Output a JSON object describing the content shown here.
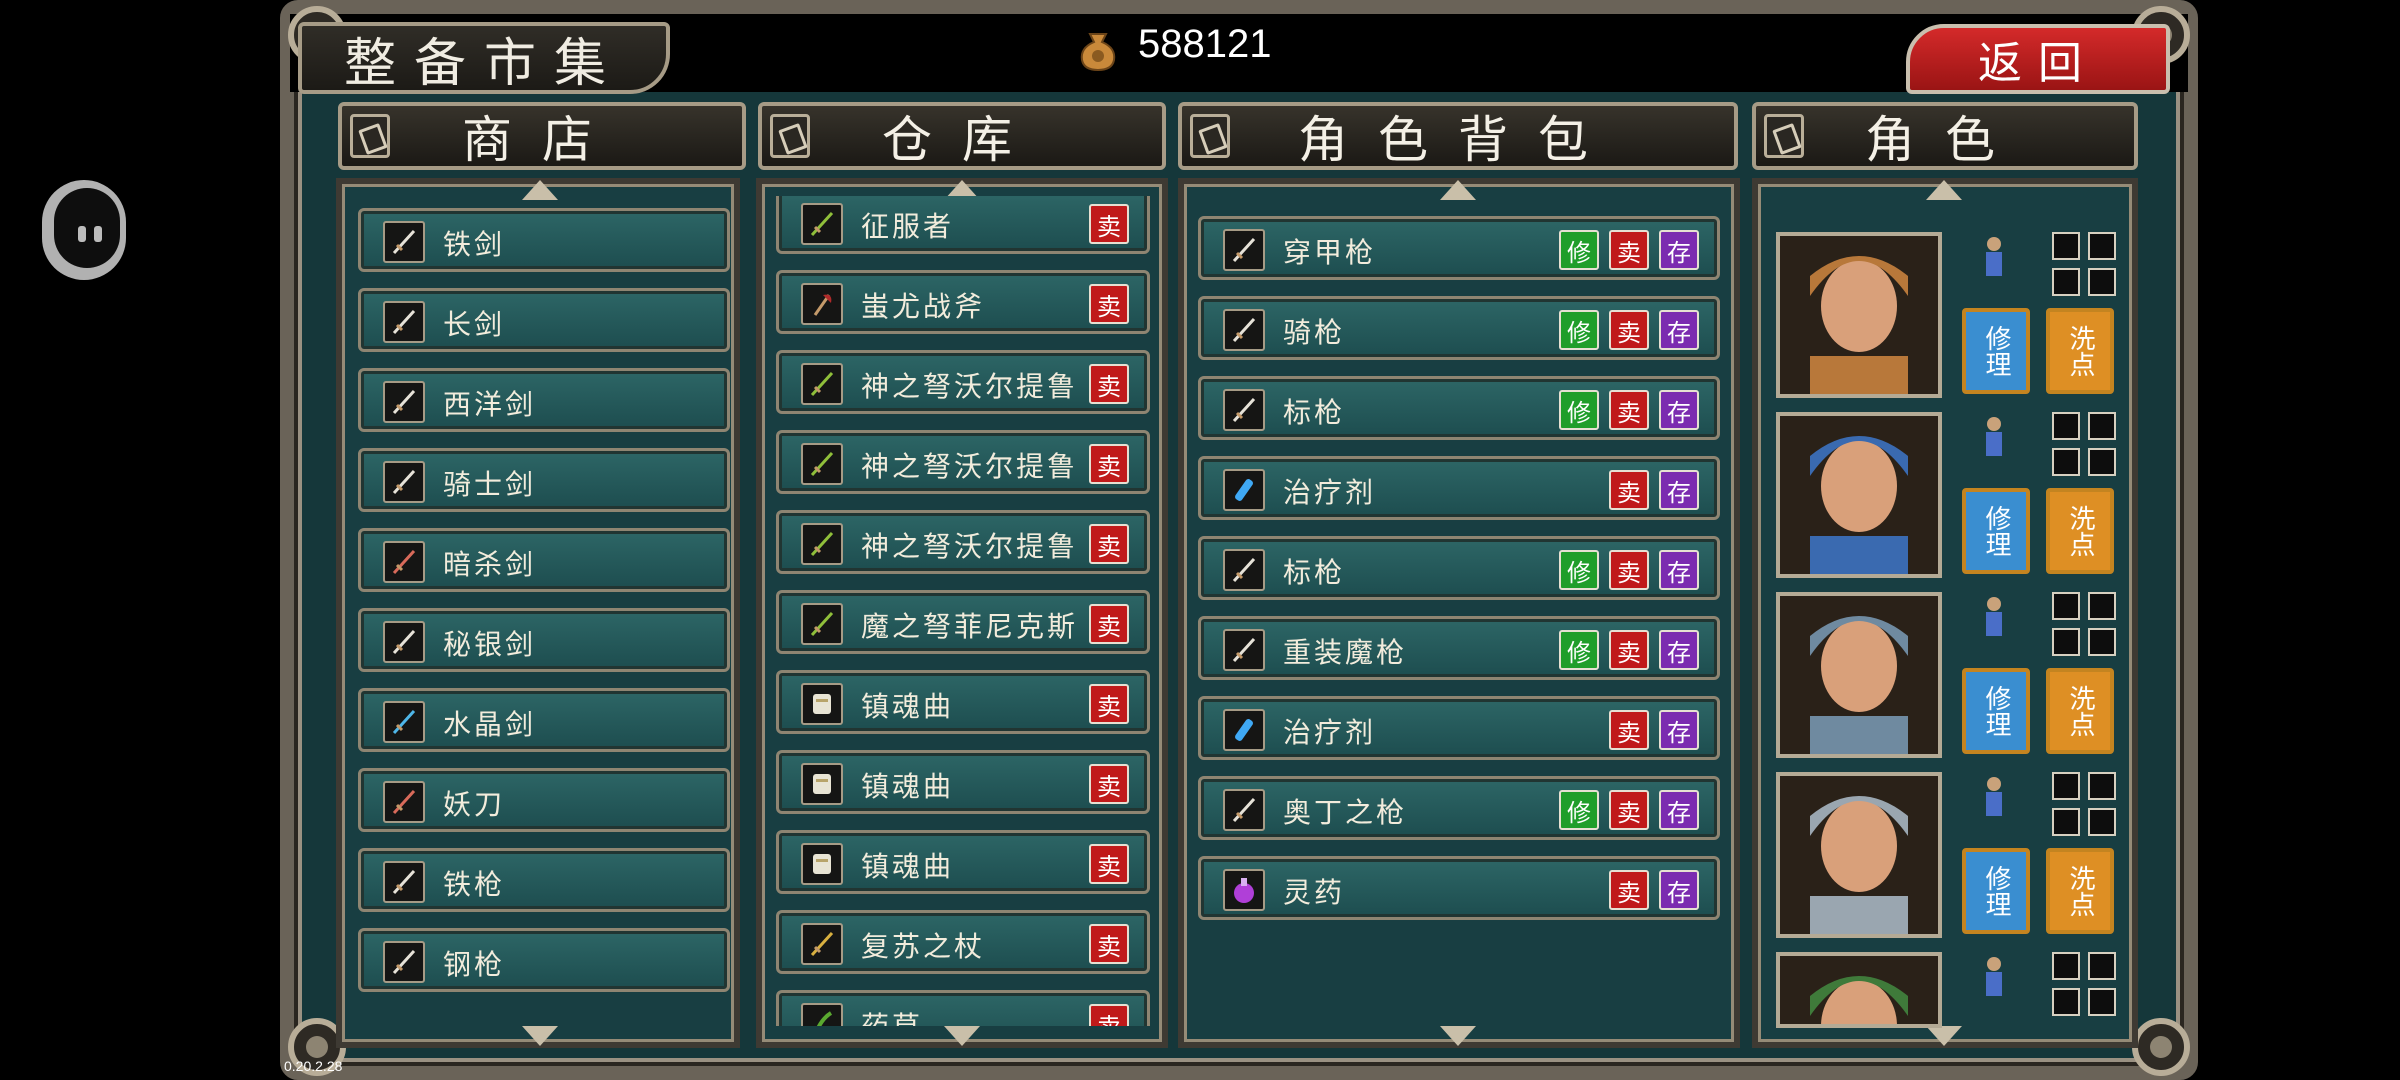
{
  "header": {
    "title": "整备市集",
    "gold_amount": "588121",
    "back_label": "返回",
    "gold_icon": "coin-bag-icon"
  },
  "columns": {
    "shop": "商店",
    "warehouse": "仓库",
    "backpack": "角色背包",
    "characters": "角色"
  },
  "buttons": {
    "sell": "卖",
    "repair": "修",
    "store": "存",
    "char_repair": "修理",
    "char_reset": "洗点"
  },
  "shop_items": [
    {
      "name": "铁剑",
      "icon": "sword-icon"
    },
    {
      "name": "长剑",
      "icon": "sword-icon"
    },
    {
      "name": "西洋剑",
      "icon": "rapier-icon"
    },
    {
      "name": "骑士剑",
      "icon": "sword-icon"
    },
    {
      "name": "暗杀剑",
      "icon": "dagger-icon"
    },
    {
      "name": "秘银剑",
      "icon": "sword-icon"
    },
    {
      "name": "水晶剑",
      "icon": "crystal-sword-icon"
    },
    {
      "name": "妖刀",
      "icon": "katana-icon"
    },
    {
      "name": "铁枪",
      "icon": "spear-icon"
    },
    {
      "name": "钢枪",
      "icon": "spear-icon"
    }
  ],
  "warehouse_items": [
    {
      "name": "征服者",
      "icon": "crossbow-icon"
    },
    {
      "name": "蚩尤战斧",
      "icon": "axe-icon"
    },
    {
      "name": "神之弩沃尔提鲁",
      "icon": "crossbow-icon"
    },
    {
      "name": "神之弩沃尔提鲁",
      "icon": "crossbow-icon"
    },
    {
      "name": "神之弩沃尔提鲁",
      "icon": "crossbow-icon"
    },
    {
      "name": "魔之弩菲尼克斯",
      "icon": "crossbow-icon"
    },
    {
      "name": "镇魂曲",
      "icon": "scroll-icon"
    },
    {
      "name": "镇魂曲",
      "icon": "scroll-icon"
    },
    {
      "name": "镇魂曲",
      "icon": "scroll-icon"
    },
    {
      "name": "复苏之杖",
      "icon": "staff-icon"
    },
    {
      "name": "药草",
      "icon": "herb-icon"
    }
  ],
  "backpack_items": [
    {
      "name": "穿甲枪",
      "icon": "spear-icon",
      "repairable": true
    },
    {
      "name": "骑枪",
      "icon": "lance-icon",
      "repairable": true
    },
    {
      "name": "标枪",
      "icon": "javelin-icon",
      "repairable": true
    },
    {
      "name": "治疗剂",
      "icon": "potion-icon",
      "repairable": false
    },
    {
      "name": "标枪",
      "icon": "javelin-icon",
      "repairable": true
    },
    {
      "name": "重装魔枪",
      "icon": "spear-icon",
      "repairable": true
    },
    {
      "name": "治疗剂",
      "icon": "potion-icon",
      "repairable": false
    },
    {
      "name": "奥丁之枪",
      "icon": "halberd-icon",
      "repairable": true
    },
    {
      "name": "灵药",
      "icon": "elixir-icon",
      "repairable": false
    }
  ],
  "characters": [
    {
      "portrait": "dancer-portrait",
      "sprite": "dancer-sprite"
    },
    {
      "portrait": "knight-portrait",
      "sprite": "mounted-knight-sprite"
    },
    {
      "portrait": "swordswoman-portrait",
      "sprite": "armored-sprite"
    },
    {
      "portrait": "silver-hair-portrait",
      "sprite": "priest-sprite"
    },
    {
      "portrait": "green-hair-portrait",
      "sprite": "soldier-sprite"
    }
  ],
  "version": "0.20.2.28",
  "colors": {
    "panel_bg": "#183e42",
    "row_bg": "#2d6666",
    "sell": "#c01a1a",
    "repair": "#1f9e2a",
    "store": "#7b2bb0",
    "char_repair": "#3a8ed0",
    "char_reset": "#de8f24",
    "back_button": "#d42a2a"
  }
}
